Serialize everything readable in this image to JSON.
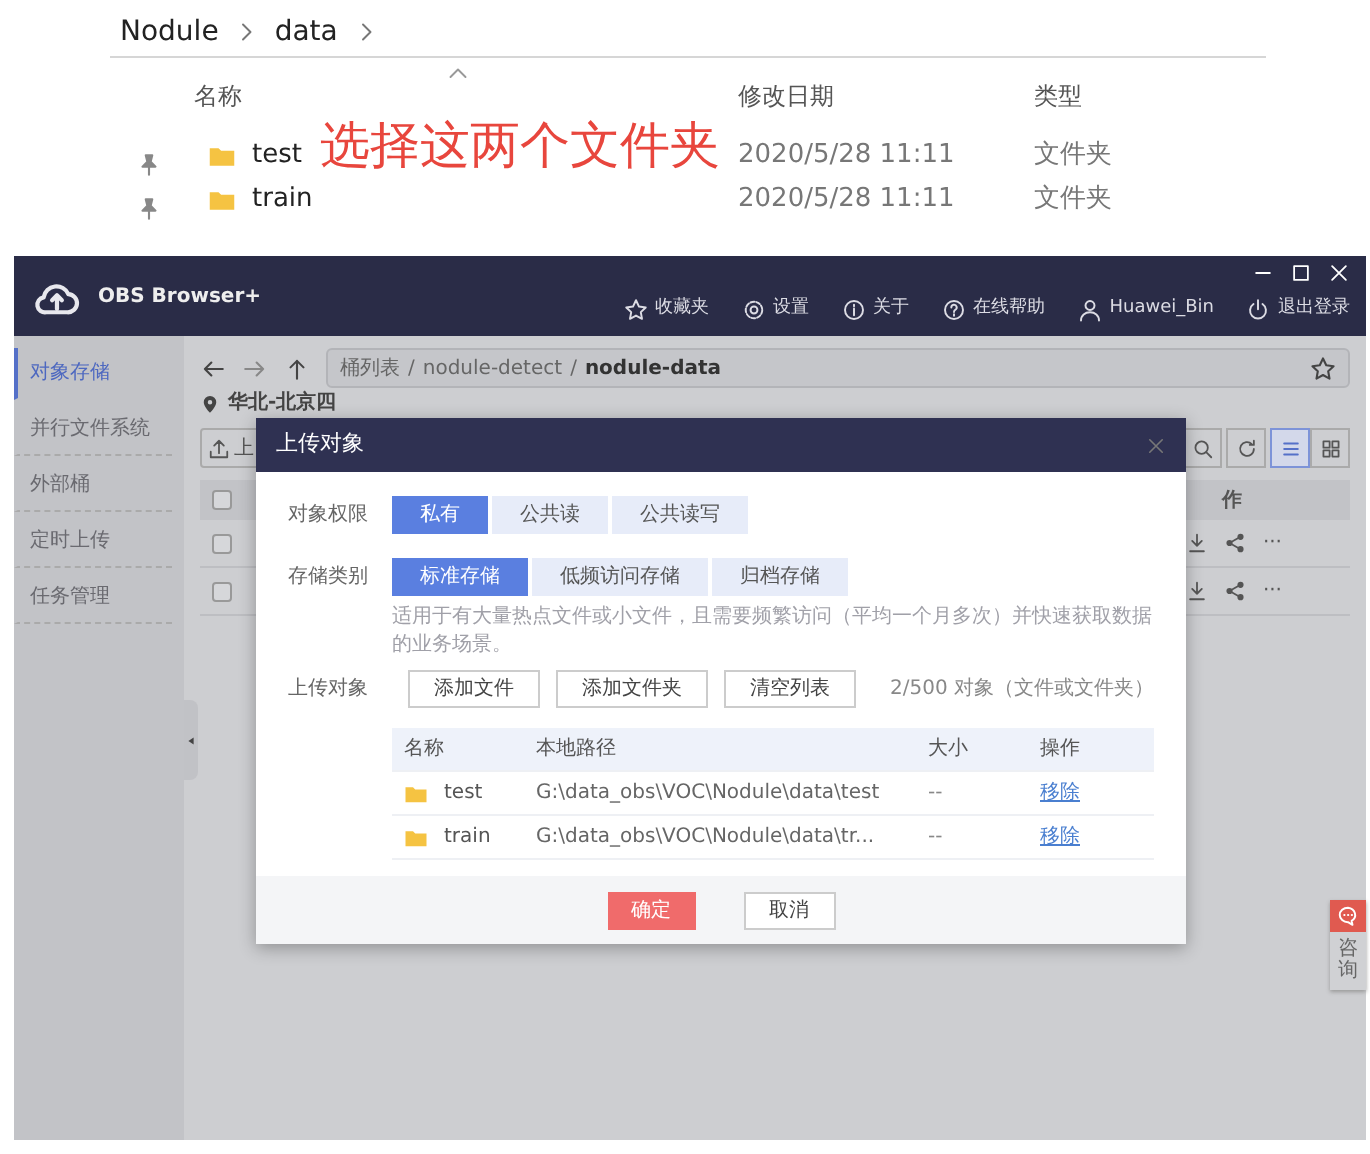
{
  "explorer": {
    "breadcrumb": [
      "Nodule",
      "data"
    ],
    "columns": [
      "名称",
      "修改日期",
      "类型"
    ],
    "rows": [
      {
        "name": "test",
        "modified": "2020/5/28 11:11",
        "type": "文件夹"
      },
      {
        "name": "train",
        "modified": "2020/5/28 11:11",
        "type": "文件夹"
      }
    ],
    "annotation": "选择这两个文件夹"
  },
  "app": {
    "title": "OBS Browser+",
    "menu": [
      {
        "kind": "star",
        "label": "收藏夹"
      },
      {
        "kind": "gear",
        "label": "设置"
      },
      {
        "kind": "info",
        "label": "关于"
      },
      {
        "kind": "help",
        "label": "在线帮助"
      },
      {
        "kind": "user",
        "label": "Huawei_Bin"
      },
      {
        "kind": "power",
        "label": "退出登录"
      }
    ],
    "sidebar": [
      {
        "label": "对象存储",
        "selected": true
      },
      {
        "label": "并行文件系统",
        "selected": false
      },
      {
        "label": "外部桶",
        "selected": false
      },
      {
        "label": "定时上传",
        "selected": false
      },
      {
        "label": "任务管理",
        "selected": false
      }
    ],
    "path": [
      "桶列表",
      "nodule-detect",
      "nodule-data"
    ],
    "path_separators": [
      "/",
      "/"
    ],
    "region": "华北-北京四",
    "upload_button": "上",
    "views": [
      {
        "kind": "list",
        "selected": true
      },
      {
        "kind": "grid",
        "selected": false
      }
    ],
    "table_header": {
      "label": "作",
      "checked": false
    },
    "table_rows": [
      {
        "more": "···",
        "checked": false
      },
      {
        "more": "···",
        "checked": false
      }
    ],
    "consult": "咨询"
  },
  "dialog": {
    "title": "上传对象",
    "permission": {
      "label": "对象权限",
      "options": [
        {
          "label": "私有",
          "selected": true
        },
        {
          "label": "公共读",
          "selected": false
        },
        {
          "label": "公共读写",
          "selected": false
        }
      ]
    },
    "storage": {
      "label": "存储类别",
      "options": [
        {
          "label": "标准存储",
          "selected": true
        },
        {
          "label": "低频访问存储",
          "selected": false
        },
        {
          "label": "归档存储",
          "selected": false
        }
      ]
    },
    "hint": "适用于有大量热点文件或小文件，且需要频繁访问（平均一个月多次）并快速获取数据的业务场景。",
    "upload": {
      "label": "上传对象",
      "buttons": [
        "添加文件",
        "添加文件夹",
        "清空列表"
      ],
      "count": "2/500 对象（文件或文件夹）"
    },
    "table": {
      "columns": [
        "名称",
        "本地路径",
        "大小",
        "操作"
      ],
      "rows": [
        {
          "name": "test",
          "path": "G:\\data_obs\\VOC\\Nodule\\data\\test",
          "size": "--",
          "action": "移除"
        },
        {
          "name": "train",
          "path": "G:\\data_obs\\VOC\\Nodule\\data\\tr...",
          "size": "--",
          "action": "移除"
        }
      ]
    },
    "confirm": "确定",
    "cancel": "取消"
  }
}
